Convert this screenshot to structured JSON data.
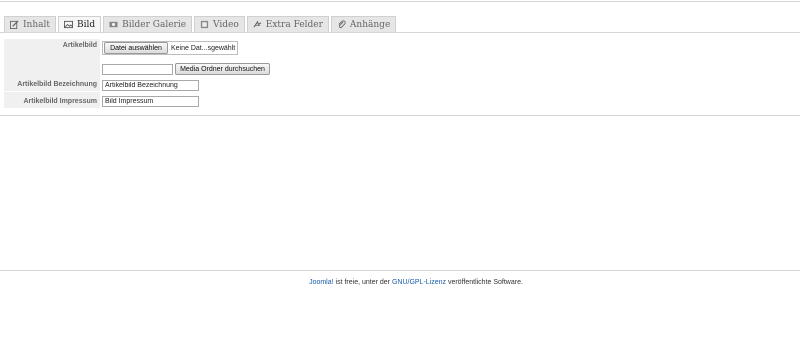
{
  "tabs": [
    {
      "label": "Inhalt",
      "icon": "edit-icon",
      "active": false
    },
    {
      "label": "Bild",
      "icon": "image-icon",
      "active": true
    },
    {
      "label": "Bilder Galerie",
      "icon": "gallery-icon",
      "active": false
    },
    {
      "label": "Video",
      "icon": "film-icon",
      "active": false
    },
    {
      "label": "Extra Felder",
      "icon": "fields-icon",
      "active": false
    },
    {
      "label": "Anhänge",
      "icon": "paperclip-icon",
      "active": false
    }
  ],
  "form": {
    "artikelbild_label": "Artikelbild",
    "file_button_label": "Datei auswählen",
    "file_status": "Keine Dat...sgewählt",
    "media_path_value": "",
    "media_browse_label": "Media Ordner durchsuchen",
    "bezeichnung_label": "Artikelbild Bezeichnung",
    "bezeichnung_value": "Artikelbild Bezeichnung",
    "impressum_label": "Artikelbild Impressum",
    "impressum_value": "Bild Impressum"
  },
  "footer": {
    "joomla_link": "Joomla!",
    "text_1": " ist freie, unter der ",
    "license_link": "GNU/GPL-Lizenz",
    "text_2": " veröffentlichte Software."
  },
  "colors": {
    "link": "#1a5ea8",
    "tab_bg": "#e6e6e6",
    "label_bg": "#f0f0f0"
  }
}
